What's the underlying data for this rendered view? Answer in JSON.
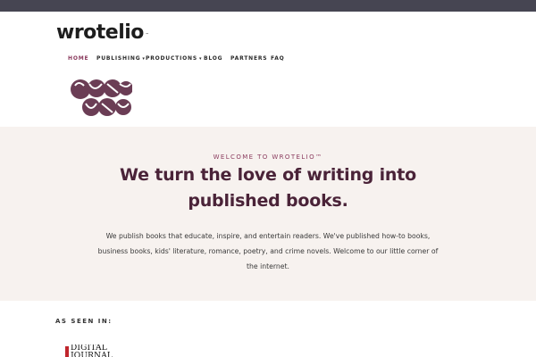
{
  "brand": {
    "name": "wrotelio",
    "tm": "™"
  },
  "nav": {
    "items": [
      {
        "label": "HOME",
        "active": true,
        "dropdown": false
      },
      {
        "label": "PUBLISHING",
        "active": false,
        "dropdown": true
      },
      {
        "label": "PRODUCTIONS",
        "active": false,
        "dropdown": true
      },
      {
        "label": "BLOG",
        "active": false,
        "dropdown": false
      },
      {
        "label": "PARTNERS",
        "active": false,
        "dropdown": false
      },
      {
        "label": "FAQ",
        "active": false,
        "dropdown": false
      }
    ],
    "caret": "▾"
  },
  "hero": {
    "eyebrow": "WELCOME TO WROTELIO™",
    "headline": "We turn the love of writing into published books.",
    "intro": "We publish books that educate, inspire, and entertain readers. We've published how-to books, business books, kids' literature, romance, poetry, and crime novels. Welcome to our little corner of the internet."
  },
  "press": {
    "heading": "AS SEEN IN:",
    "logo_text": "DIGITAL JOURNAL"
  },
  "colors": {
    "topbar": "#464552",
    "accent": "#8a3a5d",
    "headline": "#4a2338",
    "hero_bg": "#f7f2ef"
  }
}
